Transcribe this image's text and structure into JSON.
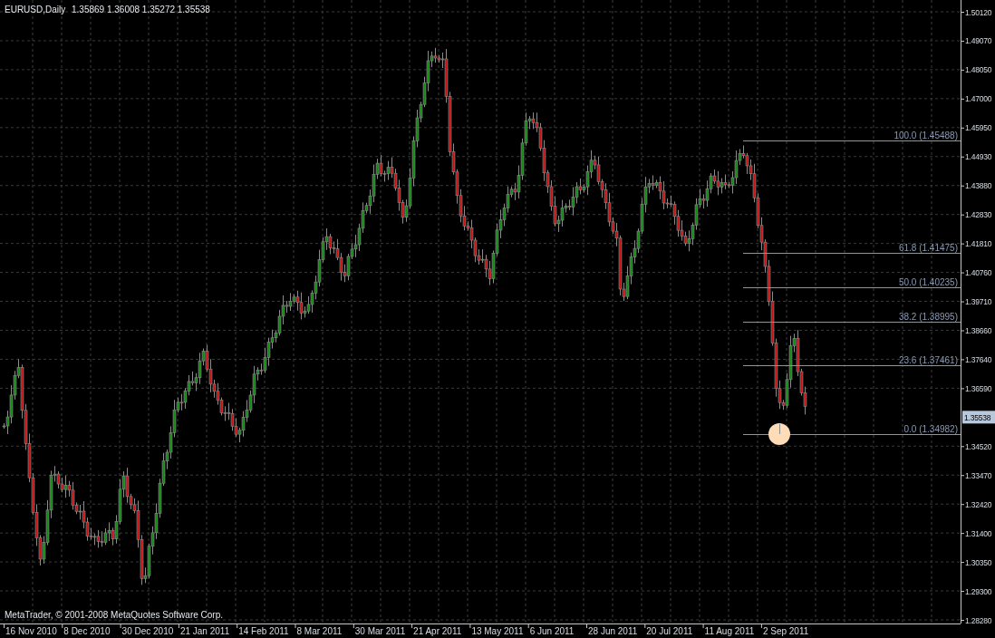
{
  "chart_header": {
    "symbol": "EURUSD,Daily",
    "ohlc": [
      "1.35869",
      "1.36008",
      "1.35272",
      "1.35538"
    ]
  },
  "price_axis": [
    "1.50120",
    "1.49070",
    "1.48050",
    "1.47000",
    "1.45950",
    "1.44930",
    "1.43880",
    "1.42830",
    "1.41810",
    "1.40760",
    "1.39710",
    "1.38660",
    "1.37640",
    "1.36590",
    "1.34520",
    "1.33470",
    "1.32420",
    "1.31400",
    "1.30350",
    "1.29300",
    "1.28280"
  ],
  "current_price": {
    "label": "1.35538"
  },
  "time_axis": [
    "16 Nov 2010",
    "8 Dec 2010",
    "30 Dec 2010",
    "21 Jan 2011",
    "14 Feb 2011",
    "8 Mar 2011",
    "30 Mar 2011",
    "21 Apr 2011",
    "13 May 2011",
    "6 Jun 2011",
    "28 Jun 2011",
    "20 Jul 2011",
    "11 Aug 2011",
    "2 Sep 2011"
  ],
  "fibonacci": [
    {
      "percent": "100.0",
      "price": "(1.45488)"
    },
    {
      "percent": "61.8",
      "price": "(1.41475)"
    },
    {
      "percent": "50.0",
      "price": "(1.40235)"
    },
    {
      "percent": "38.2",
      "price": "(1.38995)"
    },
    {
      "percent": "23.6",
      "price": "(1.37461)"
    },
    {
      "percent": "0.0",
      "price": "(1.34982)"
    }
  ],
  "copyright": "MetaTrader, © 2001-2008 MetaQuotes Software Corp."
}
